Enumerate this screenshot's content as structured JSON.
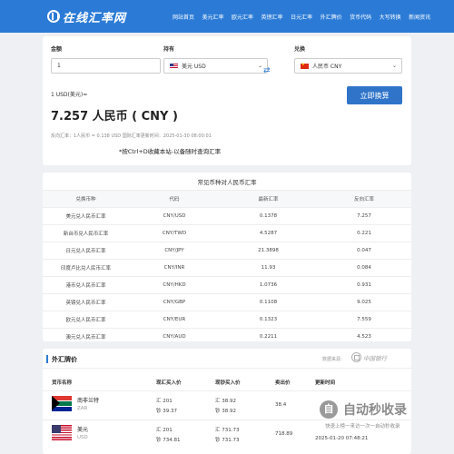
{
  "header": {
    "logo_text": "在线汇率网",
    "nav": [
      "网站首页",
      "美元汇率",
      "欧元汇率",
      "英镑汇率",
      "日元汇率",
      "外汇牌价",
      "货币代码",
      "大写转换",
      "新闻资讯"
    ]
  },
  "converter": {
    "amount_label": "金额",
    "amount_value": "1",
    "have_label": "持有",
    "have_currency": "美元 USD",
    "exchange_label": "兑换",
    "exchange_currency": "人民币 CNY",
    "swap_icon": "⇄",
    "from_line": "1 USD(美元)=",
    "result": "7.257 人民币 ( CNY )",
    "convert_button": "立即换算",
    "reverse_line": "反向汇率：1人民币 = 0.138 USD  国际汇率更新时间：2025-01-30 08:00:01",
    "tip": "*按Ctrl+D收藏本站-以备随时查询汇率"
  },
  "rates": {
    "title": "常见币种对人民币汇率",
    "headers": [
      "兑换币种",
      "代码",
      "最新汇率",
      "反向汇率"
    ],
    "rows": [
      [
        "美元兑人民币汇率",
        "CNY/USD",
        "0.1378",
        "7.257"
      ],
      [
        "新台币兑人民币汇率",
        "CNY/TWD",
        "4.5287",
        "0.221"
      ],
      [
        "日元兑人民币汇率",
        "CNY/JPY",
        "21.3898",
        "0.047"
      ],
      [
        "印度卢比兑人民币汇率",
        "CNY/INR",
        "11.93",
        "0.084"
      ],
      [
        "港币兑人民币汇率",
        "CNY/HKD",
        "1.0736",
        "0.931"
      ],
      [
        "英镑兑人民币汇率",
        "CNY/GBP",
        "0.1108",
        "9.025"
      ],
      [
        "欧元兑人民币汇率",
        "CNY/EUR",
        "0.1323",
        "7.559"
      ],
      [
        "澳元兑人民币汇率",
        "CNY/AUD",
        "0.2211",
        "4.523"
      ]
    ]
  },
  "market": {
    "title": "外汇牌价",
    "source_label": "数据来源：",
    "bank_name": "中国银行",
    "headers": [
      "货币名称",
      "现汇买入价",
      "现钞买入价",
      "卖出价",
      "更新时间"
    ],
    "rows": [
      {
        "name": "南非兰特",
        "code": "ZAR",
        "buy_fx": "汇 201",
        "buy_cash": "钞 39.37",
        "sell_fx": "汇 38.92",
        "sell_cash": "钞 38.92",
        "mid": "38.4",
        "time": ""
      },
      {
        "name": "美元",
        "code": "USD",
        "buy_fx": "汇 201",
        "buy_cash": "钞 734.81",
        "sell_fx": "汇 731.73",
        "sell_cash": "钞 731.73",
        "mid": "718.89",
        "time": "2025-01-20 07:48:21"
      }
    ]
  },
  "watermark": {
    "badge": "自",
    "text": "自动秒收录",
    "sub": "快速上榜一来访一次一自动秒收录"
  }
}
